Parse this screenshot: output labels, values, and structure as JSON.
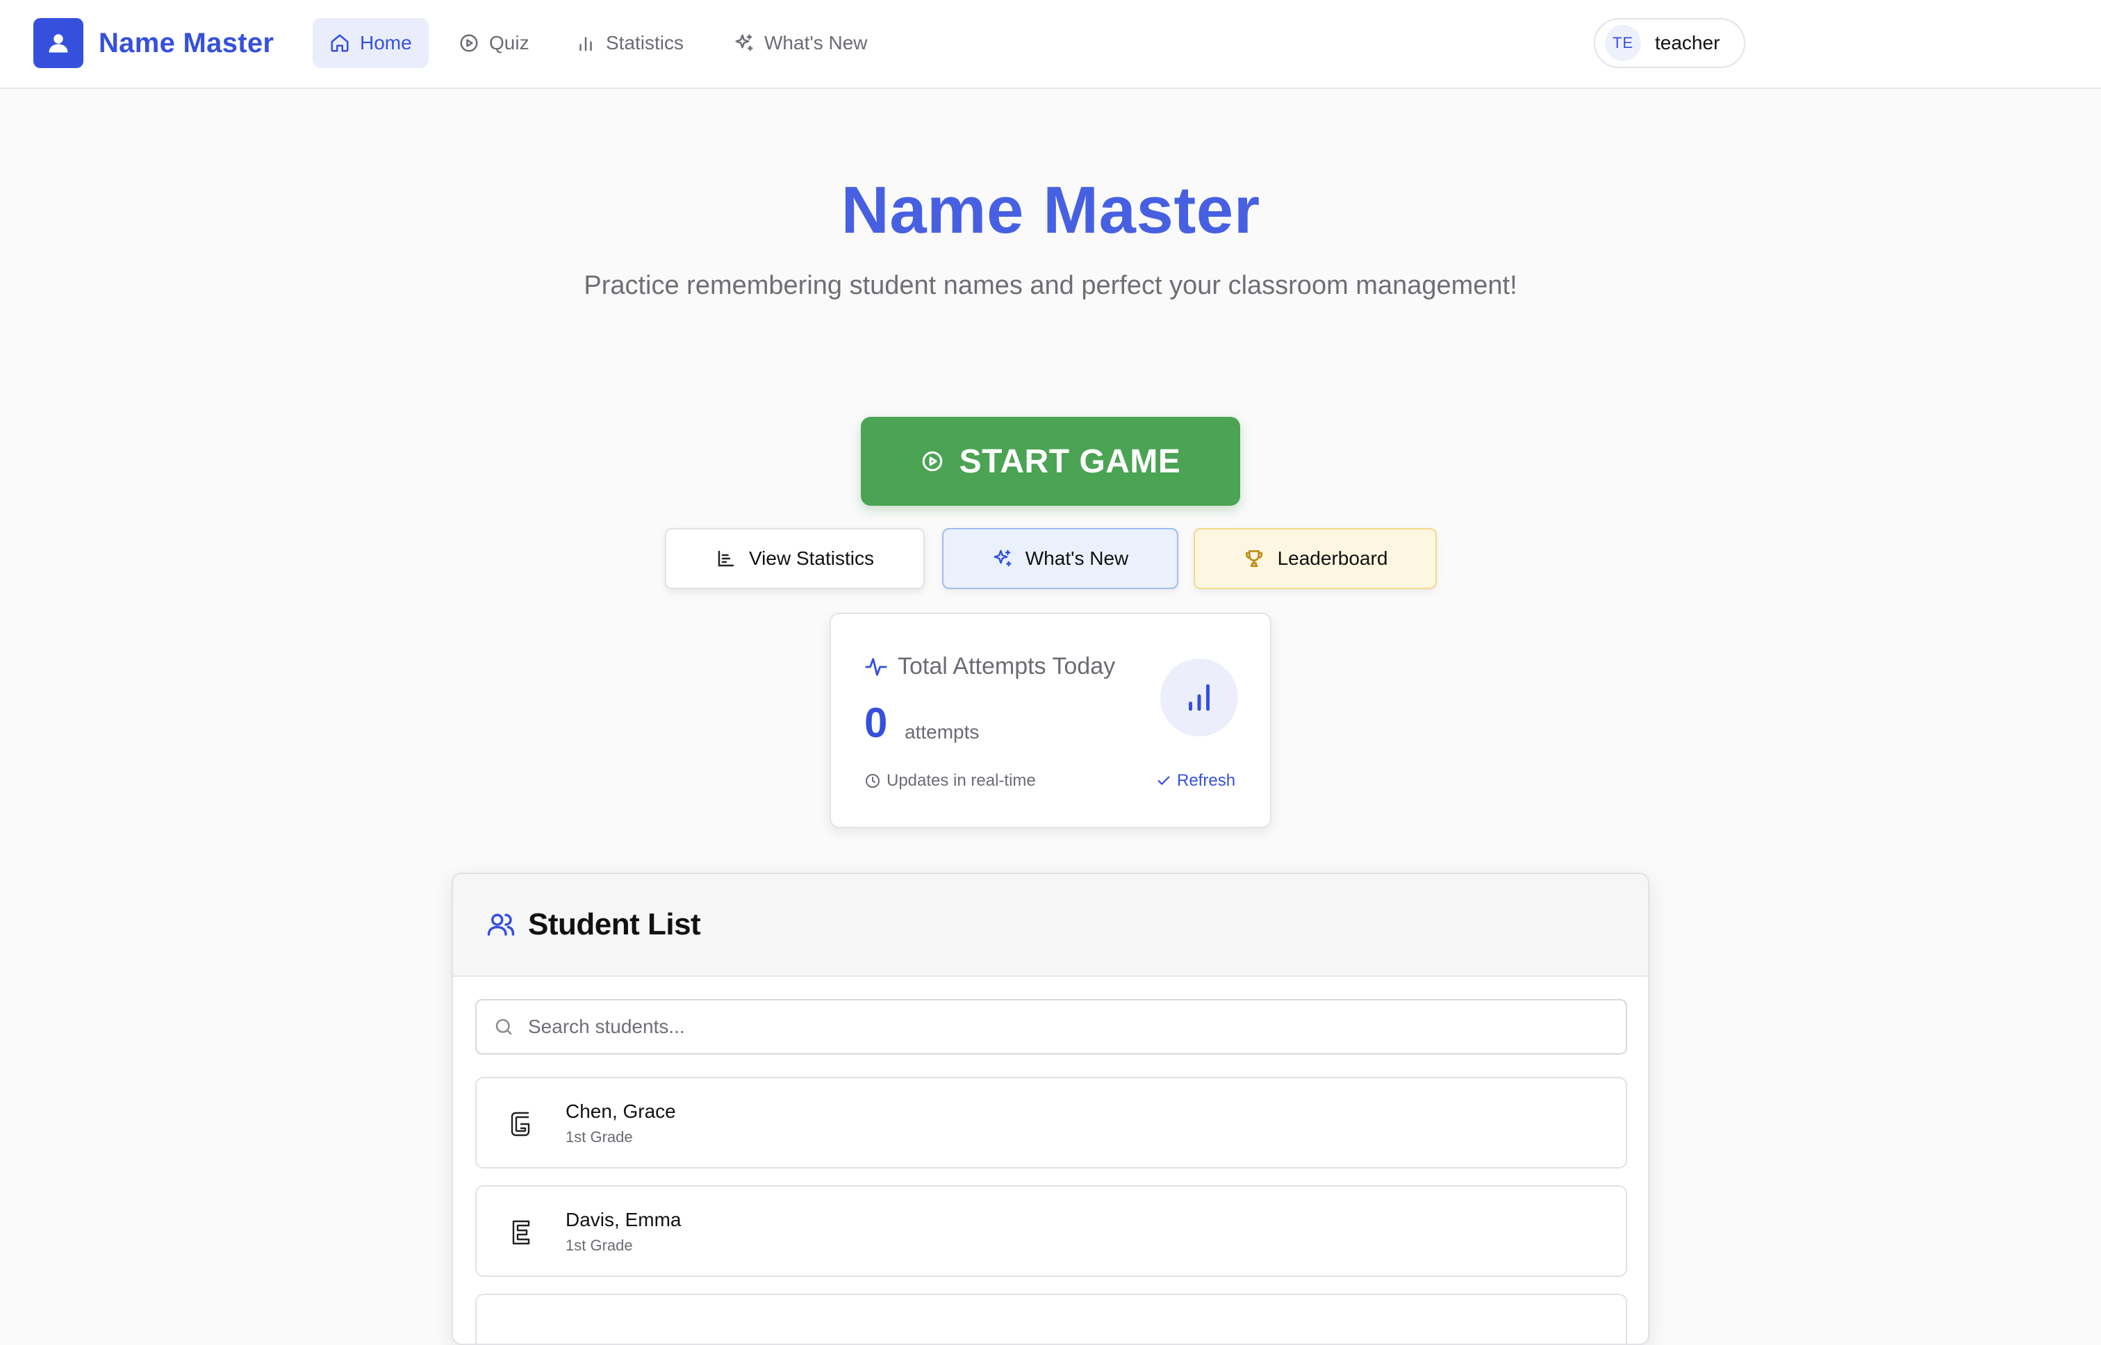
{
  "nav": {
    "brand": "Name Master",
    "items": [
      {
        "label": "Home",
        "icon": "home-icon",
        "active": true
      },
      {
        "label": "Quiz",
        "icon": "play-circle-icon",
        "active": false
      },
      {
        "label": "Statistics",
        "icon": "bar-chart-icon",
        "active": false
      },
      {
        "label": "What's New",
        "icon": "sparkles-icon",
        "active": false
      }
    ],
    "user": {
      "initials": "TE",
      "name": "teacher"
    }
  },
  "hero": {
    "title": "Name Master",
    "subtitle": "Practice remembering student names and perfect your classroom management!"
  },
  "actions": {
    "start_label": "START GAME",
    "stats_label": "View Statistics",
    "whats_new_label": "What's New",
    "leaderboard_label": "Leaderboard"
  },
  "attempts": {
    "title": "Total Attempts Today",
    "count": "0",
    "unit": "attempts",
    "footer": "Updates in real-time",
    "refresh_label": "Refresh"
  },
  "students": {
    "title": "Student List",
    "search_placeholder": "Search students...",
    "items": [
      {
        "name": "Chen, Grace",
        "grade": "1st Grade",
        "letter": "G"
      },
      {
        "name": "Davis, Emma",
        "grade": "1st Grade",
        "letter": "E"
      }
    ]
  },
  "colors": {
    "brand": "#3550dc",
    "hero_title": "#4760e2",
    "start_button": "#4ba354",
    "whats_new_bg": "#eaf1fd",
    "leaderboard_bg": "#fdf6e0"
  }
}
